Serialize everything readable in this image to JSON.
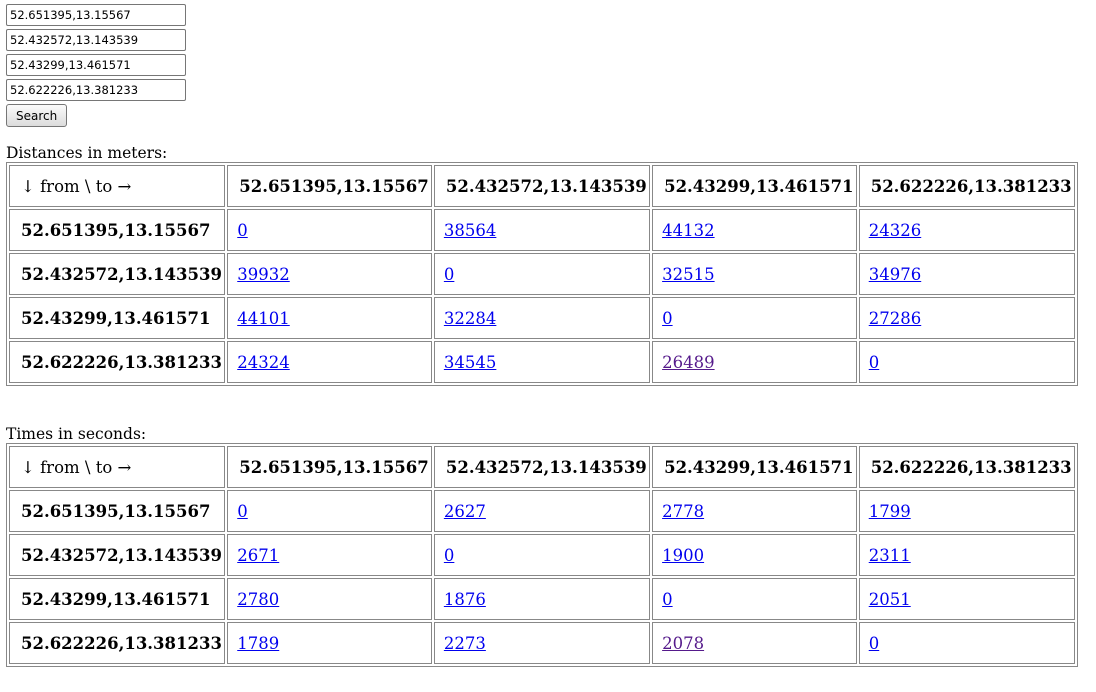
{
  "inputs": [
    "52.651395,13.15567",
    "52.432572,13.143539",
    "52.43299,13.461571",
    "52.622226,13.381233"
  ],
  "search_label": "Search",
  "corner_label": "↓ from \\ to →",
  "coords": [
    "52.651395,13.15567",
    "52.432572,13.143539",
    "52.43299,13.461571",
    "52.622226,13.381233"
  ],
  "distances": {
    "title": "Distances in meters:",
    "rows": [
      [
        "0",
        "38564",
        "44132",
        "24326"
      ],
      [
        "39932",
        "0",
        "32515",
        "34976"
      ],
      [
        "44101",
        "32284",
        "0",
        "27286"
      ],
      [
        "24324",
        "34545",
        "26489",
        "0"
      ]
    ]
  },
  "times": {
    "title": "Times in seconds:",
    "rows": [
      [
        "0",
        "2627",
        "2778",
        "1799"
      ],
      [
        "2671",
        "0",
        "1900",
        "2311"
      ],
      [
        "2780",
        "1876",
        "0",
        "2051"
      ],
      [
        "1789",
        "2273",
        "2078",
        "0"
      ]
    ]
  },
  "visited_color": "#551a8b",
  "link_color": "#0000ee"
}
